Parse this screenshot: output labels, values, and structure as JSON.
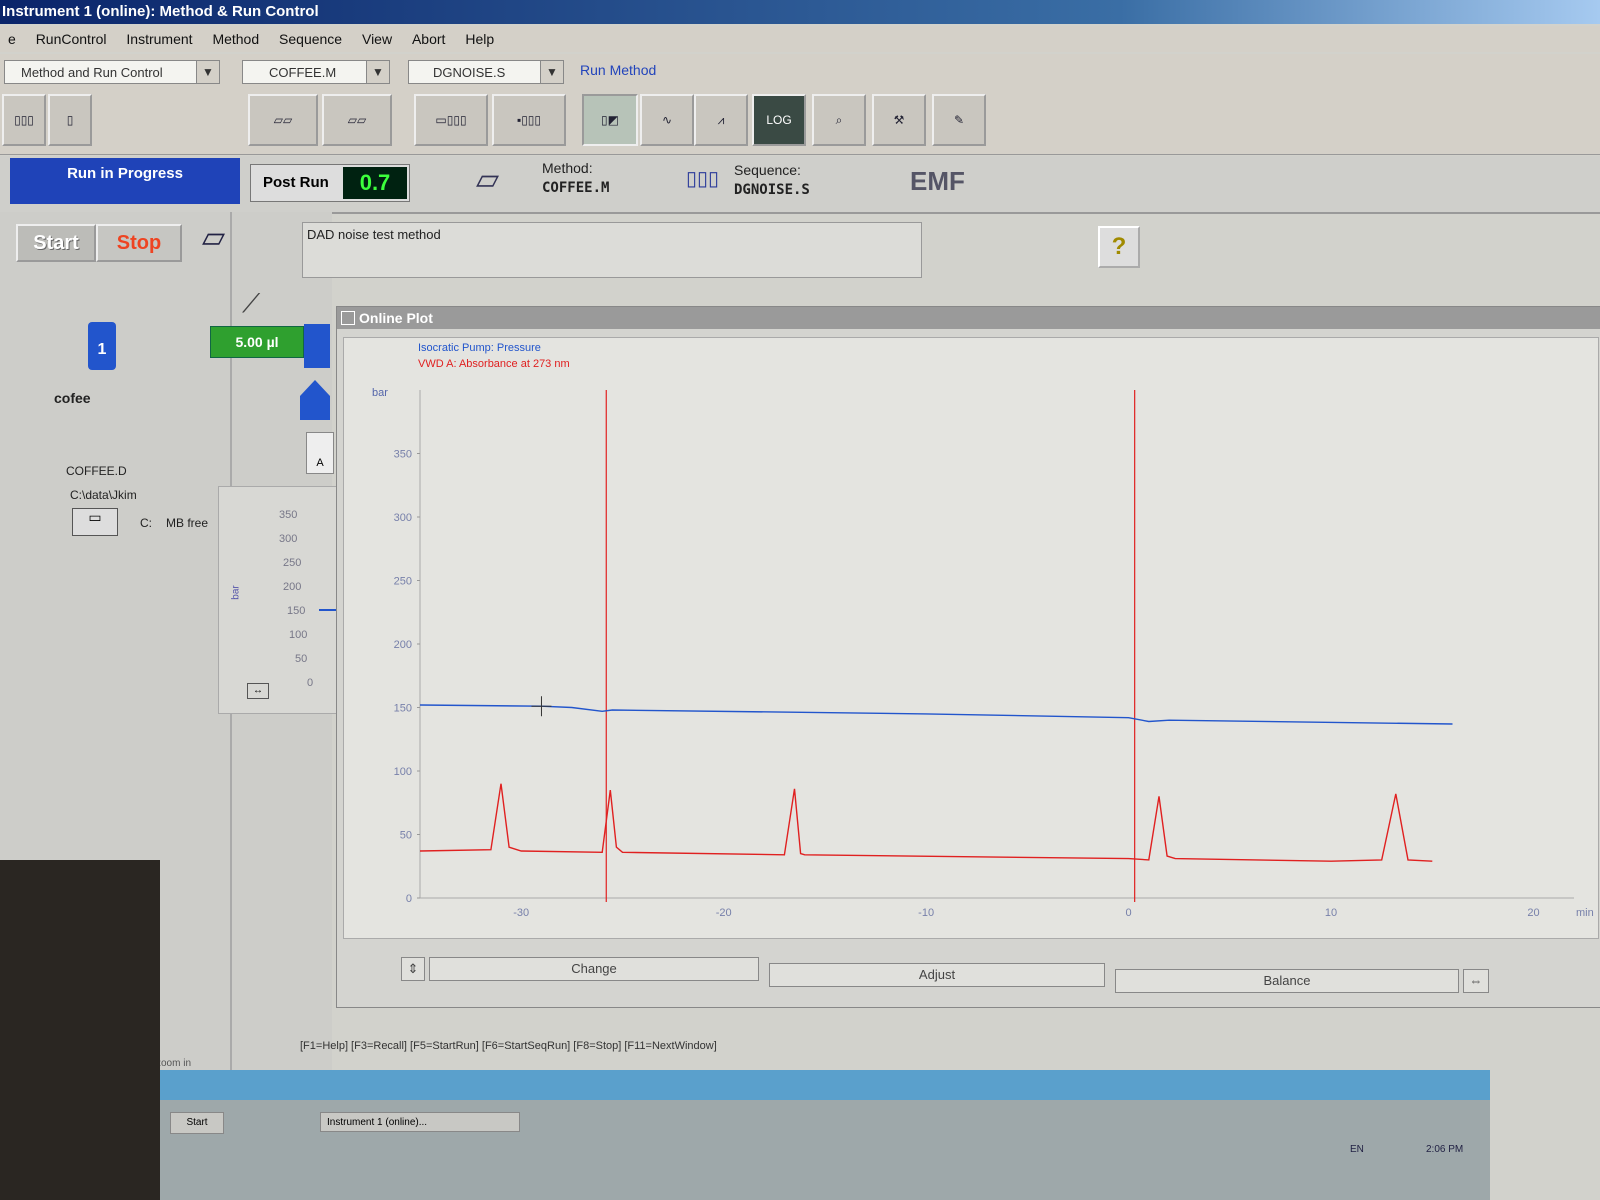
{
  "window": {
    "title": "Instrument 1 (online): Method & Run Control"
  },
  "menu": [
    "e",
    "RunControl",
    "Instrument",
    "Method",
    "Sequence",
    "View",
    "Abort",
    "Help"
  ],
  "toolbar": {
    "view_combo": "Method and Run Control",
    "method_combo": "COFFEE.M",
    "sequence_combo": "DGNOISE.S",
    "run_method_label": "Run Method",
    "log_label": "LOG"
  },
  "status": {
    "run_state": "Run in Progress",
    "post_run_label": "Post Run",
    "post_run_value": "0.7",
    "method_label": "Method:",
    "method_value": "COFFEE.M",
    "sequence_label": "Sequence:",
    "sequence_value": "DGNOISE.S",
    "emf_label": "EMF"
  },
  "controls": {
    "start_label": "Start",
    "stop_label": "Stop"
  },
  "sample": {
    "vial_number": "1",
    "name": "cofee",
    "datafile": "COFFEE.D",
    "path": "C:\\data\\Jkim",
    "drive": "C:",
    "free": "MB free",
    "injection_volume": "5.00 µl",
    "pump_channel": "A"
  },
  "method_description": "DAD noise test method",
  "help_label": "?",
  "mini_plot": {
    "unit": "bar",
    "ticks": [
      "350",
      "300",
      "250",
      "200",
      "150",
      "100",
      "50",
      "0"
    ]
  },
  "online_plot": {
    "title": "Online Plot",
    "legend": [
      "Isocratic Pump: Pressure",
      "VWD A: Absorbance at 273 nm"
    ],
    "buttons": {
      "change": "Change",
      "adjust": "Adjust",
      "balance": "Balance"
    }
  },
  "chart_data": {
    "type": "line",
    "title": "",
    "xlabel": "min",
    "ylabel": "bar",
    "xlim": [
      -35,
      22
    ],
    "ylim": [
      0,
      400
    ],
    "x_ticks": [
      "-30",
      "-20",
      "-10",
      "0",
      "10",
      "20"
    ],
    "y_ticks": [
      "0",
      "50",
      "100",
      "150",
      "200",
      "250",
      "300",
      "350"
    ],
    "series": [
      {
        "name": "Isocratic Pump: Pressure",
        "color": "#2255cc",
        "x": [
          -35,
          -29,
          -27.5,
          -26,
          -25.5,
          -10,
          0,
          1,
          2,
          16
        ],
        "y": [
          152,
          151,
          150,
          147,
          148,
          145,
          142,
          139,
          140,
          137
        ]
      },
      {
        "name": "VWD A: Absorbance at 273 nm",
        "color": "#e02020",
        "x": [
          -35,
          -31.5,
          -31,
          -30.6,
          -30,
          -26,
          -25.6,
          -25.3,
          -25,
          -17,
          -16.5,
          -16.2,
          -16,
          -5,
          0,
          1,
          1.5,
          1.9,
          2.3,
          10,
          12.5,
          13.2,
          13.8,
          15
        ],
        "y": [
          37,
          38,
          90,
          40,
          37,
          36,
          85,
          40,
          36,
          34,
          86,
          35,
          34,
          32,
          31,
          30,
          80,
          33,
          31,
          29,
          30,
          82,
          30,
          29
        ]
      }
    ],
    "markers": [
      {
        "x": -25.8,
        "color": "#e02020"
      },
      {
        "x": 0.3,
        "color": "#e02020"
      }
    ],
    "grid": false
  },
  "function_keys": "[F1=Help] [F3=Recall] [F5=StartRun] [F6=StartSeqRun] [F8=Stop] [F11=NextWindow]",
  "statusbar_left": "zoom in",
  "taskbar": {
    "start": "Start",
    "window": "Instrument 1 (online)...",
    "lang": "EN",
    "time": "2:06 PM"
  }
}
